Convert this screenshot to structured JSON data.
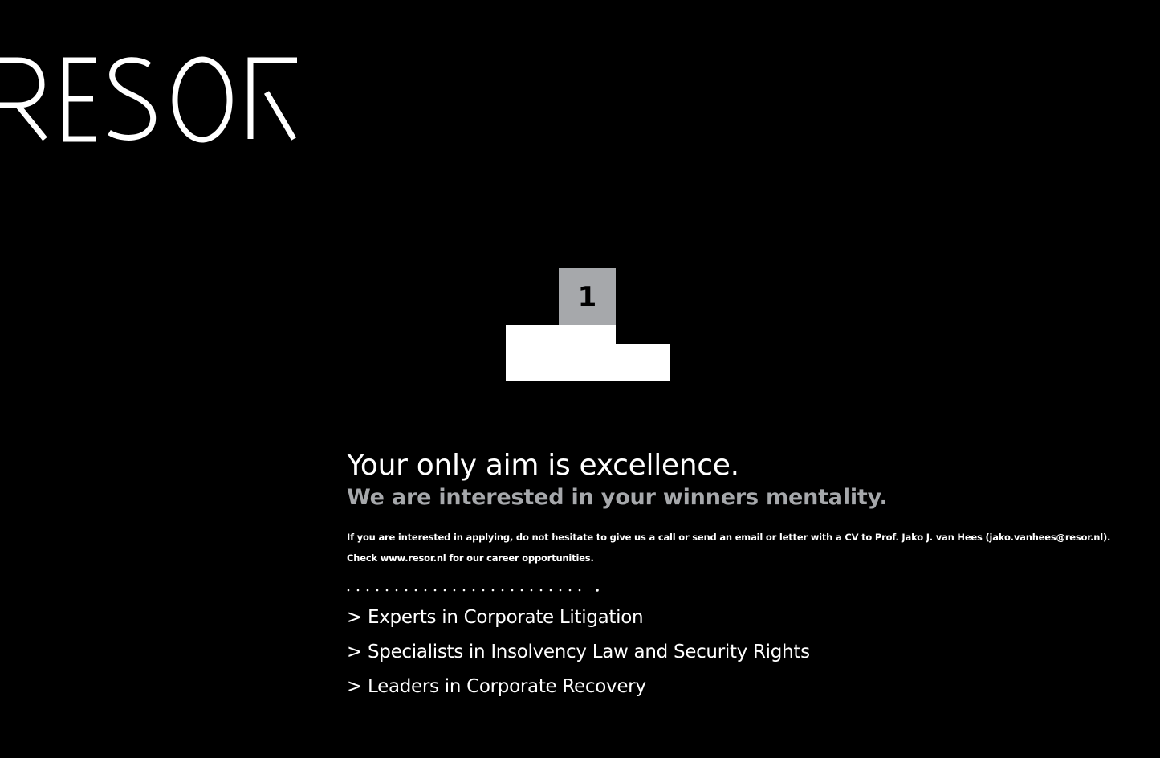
{
  "brand": {
    "name": "RESOR",
    "colors": {
      "background": "#000000",
      "text": "#ffffff",
      "accent_grey": "#a6a8ab"
    }
  },
  "podium": {
    "first_place_label": "1"
  },
  "headline": "Your only aim is excellence.",
  "subheadline": "We are interested in your winners mentality.",
  "body_text": "If you are interested in applying, do not hesitate to give us a call or send an email or letter with a CV to Prof. Jako J. van Hees (jako.vanhees@resor.nl). Check www.resor.nl for our career opportunities.",
  "bullets": [
    "> Experts in Corporate Litigation",
    "> Specialists in Insolvency Law and Security Rights",
    "> Leaders in Corporate Recovery"
  ]
}
